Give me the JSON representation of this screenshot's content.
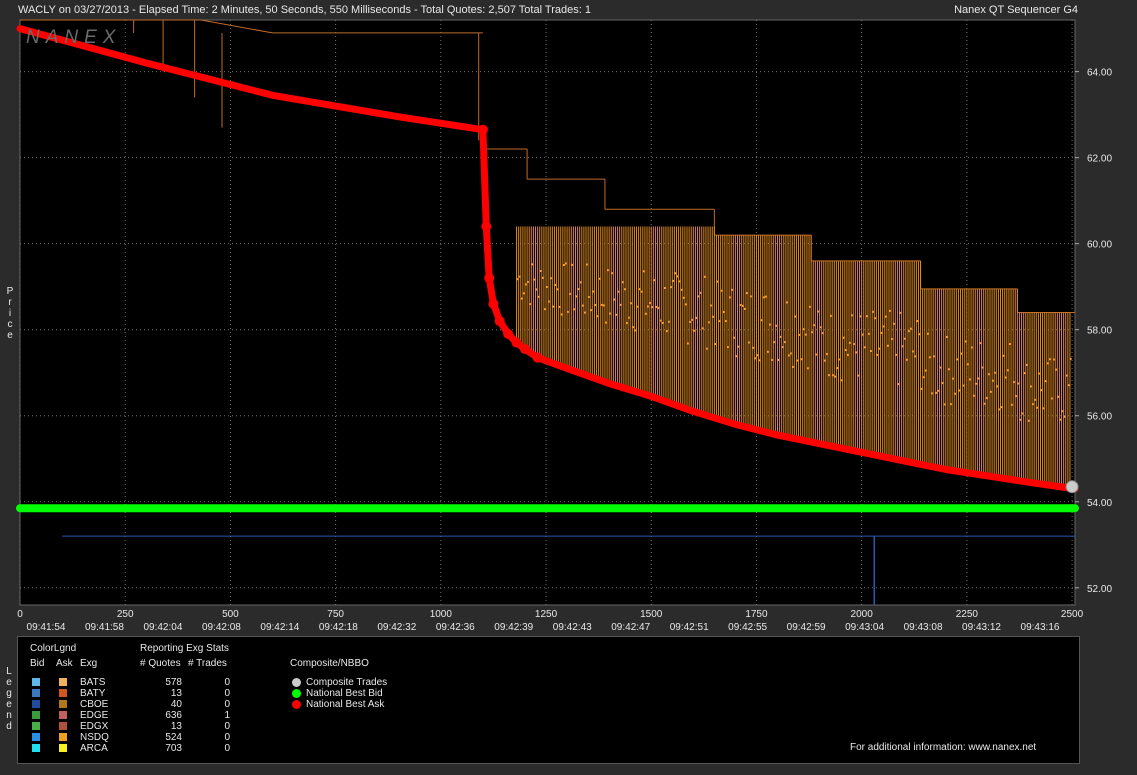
{
  "header": {
    "title": "WACLY on 03/27/2013  -  Elapsed Time: 2 Minutes, 50 Seconds, 550 Milliseconds  -  Total Quotes: 2,507  Total Trades: 1",
    "app_name": "Nanex QT Sequencer G4",
    "watermark": "NANEX"
  },
  "y_axis_title": "Price",
  "legend_title_vertical": "Legend",
  "chart_data": {
    "type": "line",
    "x_range": [
      0,
      2507
    ],
    "ylim": [
      51.6,
      65.2
    ],
    "grid": true,
    "x_ticks": [
      0,
      250,
      500,
      750,
      1000,
      1250,
      1500,
      1750,
      2000,
      2250,
      2500
    ],
    "x_tick_labels": [
      "0",
      "250",
      "500",
      "750",
      "1000",
      "1250",
      "1500",
      "1750",
      "2000",
      "2250",
      "2500"
    ],
    "y_ticks": [
      52,
      54,
      56,
      58,
      60,
      62,
      64
    ],
    "y_tick_labels": [
      "52.00",
      "54.00",
      "56.00",
      "58.00",
      "60.00",
      "62.00",
      "64.00"
    ],
    "time_labels": [
      "09:41:54",
      "09:41:58",
      "09:42:04",
      "09:42:08",
      "09:42:14",
      "09:42:18",
      "09:42:32",
      "09:42:36",
      "09:42:39",
      "09:42:43",
      "09:42:47",
      "09:42:51",
      "09:42:55",
      "09:42:59",
      "09:43:04",
      "09:43:08",
      "09:43:12",
      "09:43:16"
    ],
    "series": [
      {
        "name": "National Best Ask",
        "color": "#ff0000",
        "x": [
          0,
          300,
          600,
          900,
          1100,
          1108,
          1115,
          1125,
          1140,
          1160,
          1180,
          1200,
          1230,
          1300,
          1400,
          1500,
          1600,
          1700,
          1800,
          1900,
          2000,
          2100,
          2200,
          2300,
          2400,
          2507
        ],
        "y": [
          65.0,
          64.2,
          63.45,
          62.95,
          62.65,
          60.4,
          59.2,
          58.6,
          58.2,
          57.9,
          57.7,
          57.55,
          57.35,
          57.1,
          56.75,
          56.45,
          56.1,
          55.8,
          55.55,
          55.35,
          55.15,
          54.95,
          54.75,
          54.6,
          54.45,
          54.3
        ]
      },
      {
        "name": "National Best Bid",
        "color": "#00ff00",
        "x": [
          0,
          2507
        ],
        "y": [
          53.85,
          53.85
        ]
      },
      {
        "name": "Composite Trades",
        "color": "#cccccc",
        "x": [
          2500
        ],
        "y": [
          54.35
        ]
      }
    ],
    "ask_step_levels": [
      {
        "x": [
          0,
          430
        ],
        "y": [
          65.2,
          65.2
        ]
      },
      {
        "x": [
          430,
          600
        ],
        "y": [
          65.2,
          64.9
        ]
      },
      {
        "x": [
          600,
          1100
        ],
        "y": [
          64.9,
          64.9
        ]
      },
      {
        "x": [
          1100,
          1205
        ],
        "y": [
          62.2,
          62.2
        ]
      },
      {
        "x": [
          1205,
          1390
        ],
        "y": [
          61.5,
          61.5
        ]
      },
      {
        "x": [
          1390,
          1650
        ],
        "y": [
          60.8,
          60.8
        ]
      },
      {
        "x": [
          1650,
          1880
        ],
        "y": [
          60.2,
          60.2
        ]
      },
      {
        "x": [
          1880,
          2140
        ],
        "y": [
          59.6,
          59.6
        ]
      },
      {
        "x": [
          2140,
          2370
        ],
        "y": [
          58.95,
          58.95
        ]
      },
      {
        "x": [
          2370,
          2507
        ],
        "y": [
          58.4,
          58.4
        ]
      }
    ],
    "bid_trace_level": 53.2
  },
  "legend": {
    "color_legend_label": "ColorLgnd",
    "reporting_label": "Reporting Exg Stats",
    "col_bid": "Bid",
    "col_ask": "Ask",
    "col_exg": "Exg",
    "col_quotes": "# Quotes",
    "col_trades": "# Trades",
    "composite_title": "Composite/NBBO",
    "exchanges": [
      {
        "name": "BATS",
        "quotes": "578",
        "trades": "0",
        "bid_color": "#5fb8e8",
        "ask_color": "#f0b060"
      },
      {
        "name": "BATY",
        "quotes": "13",
        "trades": "0",
        "bid_color": "#3a78c0",
        "ask_color": "#d05820"
      },
      {
        "name": "CBOE",
        "quotes": "40",
        "trades": "0",
        "bid_color": "#1f4c9c",
        "ask_color": "#b07818"
      },
      {
        "name": "EDGE",
        "quotes": "636",
        "trades": "1",
        "bid_color": "#3c9a3c",
        "ask_color": "#c06060"
      },
      {
        "name": "EDGX",
        "quotes": "13",
        "trades": "0",
        "bid_color": "#49b049",
        "ask_color": "#b05040"
      },
      {
        "name": "NSDQ",
        "quotes": "524",
        "trades": "0",
        "bid_color": "#2a90e0",
        "ask_color": "#f0a020"
      },
      {
        "name": "ARCA",
        "quotes": "703",
        "trades": "0",
        "bid_color": "#20e0f0",
        "ask_color": "#f8f020"
      }
    ],
    "composite_items": [
      {
        "label": "Composite Trades",
        "color": "#cccccc"
      },
      {
        "label": "National Best Bid",
        "color": "#00ff00"
      },
      {
        "label": "National Best Ask",
        "color": "#ff0000"
      }
    ],
    "footer": "For additional information: www.nanex.net"
  }
}
